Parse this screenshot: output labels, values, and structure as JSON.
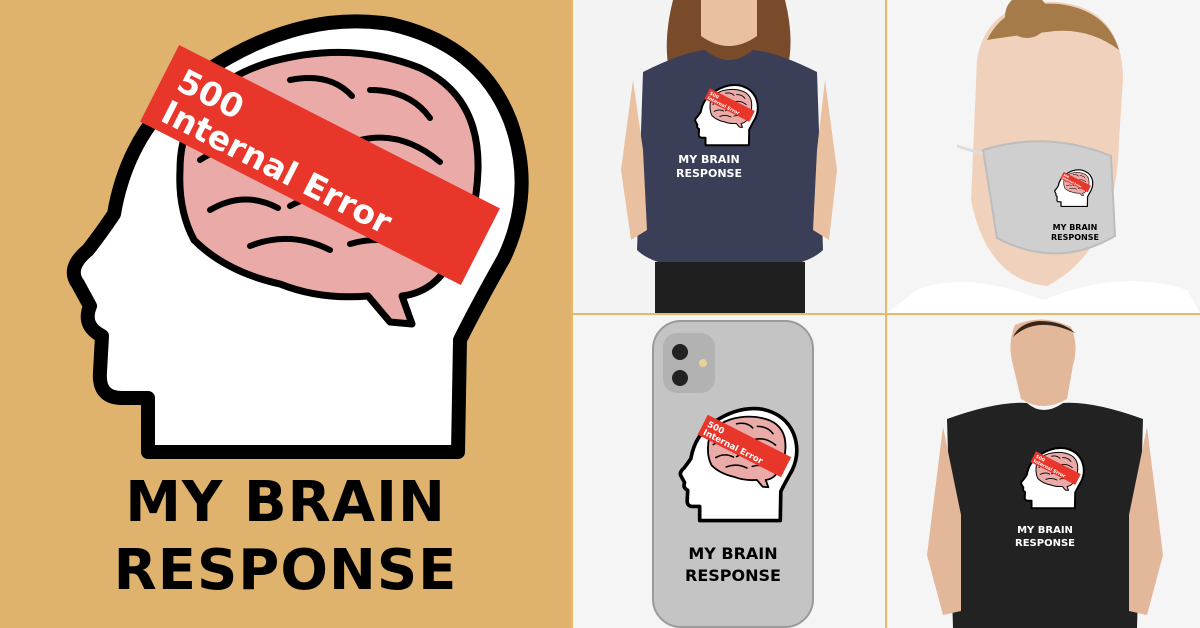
{
  "design": {
    "badge_line1": "500",
    "badge_line2": "Internal Error",
    "title_line1": "MY BRAIN",
    "title_line2": "RESPONSE"
  },
  "colors": {
    "background": "#dfb36e",
    "band": "#e8362b",
    "brain": "#e9aaa8",
    "outline": "#000000",
    "tile_border": "#e7b866",
    "tshirt_navy": "#3a3f57",
    "tshirt_black": "#222222",
    "phone_case": "#c4c4c4",
    "mask": "#d0d0d0"
  },
  "products": [
    {
      "name": "fitted-tshirt"
    },
    {
      "name": "face-mask"
    },
    {
      "name": "phone-case"
    },
    {
      "name": "triblend-tshirt"
    }
  ]
}
